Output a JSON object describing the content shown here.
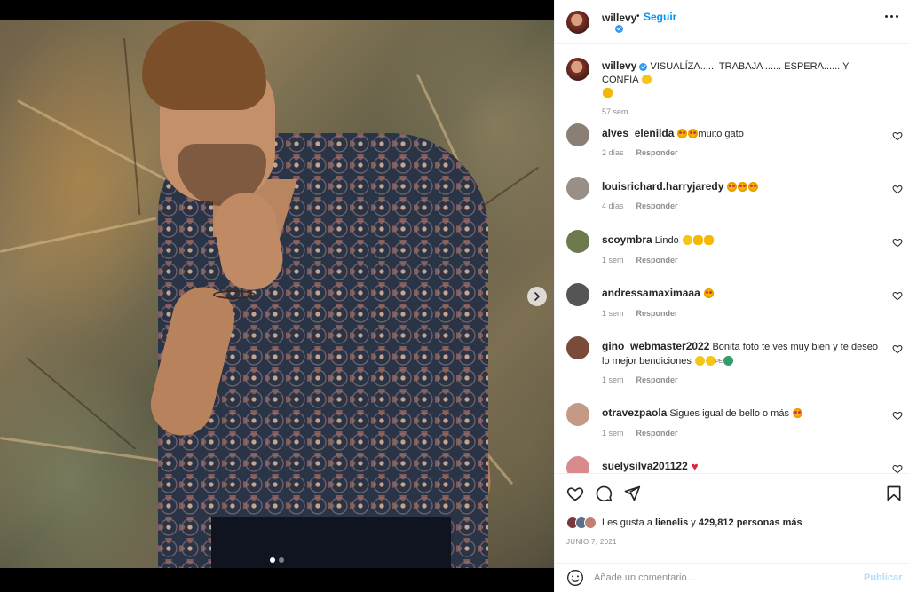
{
  "post": {
    "username": "willevy",
    "follow_label": "Seguir",
    "bullet": "•",
    "caption": "VISUALÍZA...... TRABAJA ...... ESPERA...... Y CONFIA",
    "caption_time": "57 sem",
    "likes_prefix": "Les gusta a",
    "likes_user": "lienelis",
    "likes_connector": "y",
    "likes_count": "429,812",
    "likes_suffix": "personas más",
    "date": "JUNIO 7, 2021",
    "carousel": {
      "slides": 2,
      "active": 1
    }
  },
  "comments": [
    {
      "user": "alves_elenilda",
      "text": "muito gato",
      "time": "2 días",
      "reply": "Responder",
      "avatar_color": "#8a7f74"
    },
    {
      "user": "louisrichard.harryjaredy",
      "text": "",
      "time": "4 días",
      "reply": "Responder",
      "avatar_color": "#9a8f88"
    },
    {
      "user": "scoymbra",
      "text": "Lindo",
      "time": "1 sem",
      "reply": "Responder",
      "avatar_color": "#6c7a4e"
    },
    {
      "user": "andressamaximaaa",
      "text": "",
      "time": "1 sem",
      "reply": "Responder",
      "avatar_color": "#555"
    },
    {
      "user": "gino_webmaster2022",
      "text": "Bonita foto te ves muy bien y te deseo lo mejor bendiciones",
      "time": "1 sem",
      "reply": "Responder",
      "avatar_color": "#7a4a3a",
      "tag": "PE"
    },
    {
      "user": "otravezpaola",
      "text": "Sigues igual de bello o más",
      "time": "1 sem",
      "reply": "Responder",
      "avatar_color": "#c49a86"
    },
    {
      "user": "suelysilva201122",
      "text": "",
      "time": "",
      "reply": "",
      "avatar_color": "#d98a8a"
    }
  ],
  "add_comment": {
    "placeholder": "Añade un comentario...",
    "publish_label": "Publicar"
  },
  "colors": {
    "accent": "#0095f6",
    "publish_disabled": "#b2dffc",
    "muted": "#8e8e8e",
    "text": "#262626"
  },
  "icons": {
    "like": "heart-outline-icon",
    "comment": "comment-bubble-icon",
    "share": "paper-plane-icon",
    "save": "bookmark-icon",
    "emoji": "smiley-icon",
    "more": "ellipsis-icon",
    "next": "chevron-right-icon"
  }
}
